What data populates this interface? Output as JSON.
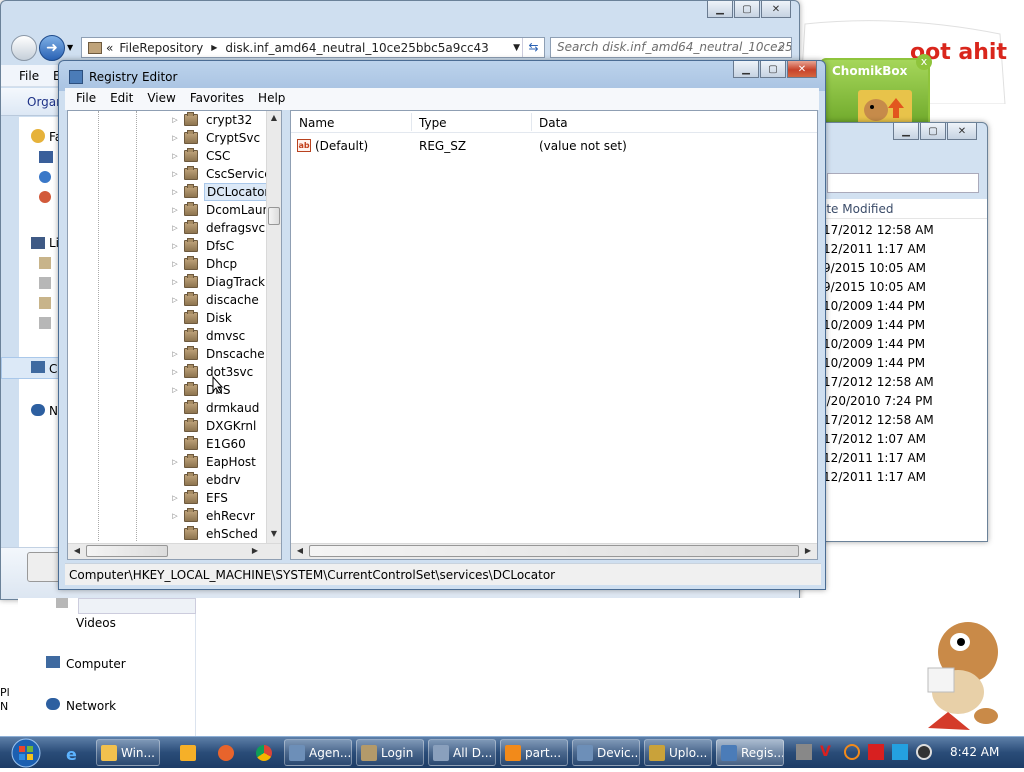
{
  "explorer_back": {
    "address": {
      "crumb1": "FileRepository",
      "crumb2": "disk.inf_amd64_neutral_10ce25bbc5a9cc43"
    },
    "search_placeholder": "Search disk.inf_amd64_neutral_10ce25...",
    "menu": {
      "file": "File",
      "edit": "E"
    },
    "organize": "Organ",
    "nav_partial": [
      "Fa",
      "Li",
      "C",
      "N"
    ],
    "nav_lower": {
      "videos": "Videos",
      "computer": "Computer",
      "network": "Network"
    }
  },
  "chomikbox": {
    "title": "ChomikBox"
  },
  "explorer_right": {
    "column_header": "ate Modified",
    "dates": [
      "/17/2012 12:58 AM",
      "/12/2011 1:17 AM",
      "/9/2015 10:05 AM",
      "/9/2015 10:05 AM",
      "/10/2009 1:44 PM",
      "/10/2009 1:44 PM",
      "/10/2009 1:44 PM",
      "/10/2009 1:44 PM",
      "/17/2012 12:58 AM",
      "1/20/2010 7:24 PM",
      "/17/2012 12:58 AM",
      "/17/2012 1:07 AM",
      "/12/2011 1:17 AM",
      "/12/2011 1:17 AM"
    ]
  },
  "regedit": {
    "title": "Registry Editor",
    "menu": [
      "File",
      "Edit",
      "View",
      "Favorites",
      "Help"
    ],
    "tree": [
      "crypt32",
      "CryptSvc",
      "CSC",
      "CscService",
      "DCLocator",
      "DcomLaun",
      "defragsvc",
      "DfsC",
      "Dhcp",
      "DiagTrack",
      "discache",
      "Disk",
      "dmvsc",
      "Dnscache",
      "dot3svc",
      "DnS",
      "drmkaud",
      "DXGKrnl",
      "E1G60",
      "EapHost",
      "ebdrv",
      "EFS",
      "ehRecvr",
      "ehSched"
    ],
    "tree_selected": "DCLocator",
    "columns": {
      "name": "Name",
      "type": "Type",
      "data": "Data"
    },
    "values": [
      {
        "name": "(Default)",
        "type": "REG_SZ",
        "data": "(value not set)",
        "icon": "ab-string-icon"
      }
    ],
    "status": "Computer\\HKEY_LOCAL_MACHINE\\SYSTEM\\CurrentControlSet\\services\\DCLocator"
  },
  "taskbar": {
    "items": [
      {
        "label": "Win...",
        "icon": "explorer-icon"
      },
      {
        "label": "Agen...",
        "icon": "window-icon"
      },
      {
        "label": "Login",
        "icon": "login-icon"
      },
      {
        "label": "All D...",
        "icon": "window-icon"
      },
      {
        "label": "part...",
        "icon": "search-icon"
      },
      {
        "label": "Devic...",
        "icon": "device-icon"
      },
      {
        "label": "Uplo...",
        "icon": "upload-icon"
      },
      {
        "label": "Regis...",
        "icon": "regedit-icon"
      }
    ],
    "clock": "8:42 AM"
  },
  "desktop": {
    "left_text": [
      "Pl",
      "N"
    ]
  },
  "colors": {
    "taskbar": "#2a4c78",
    "chomik_green": "#7bb32e",
    "close_red": "#c7432b"
  }
}
